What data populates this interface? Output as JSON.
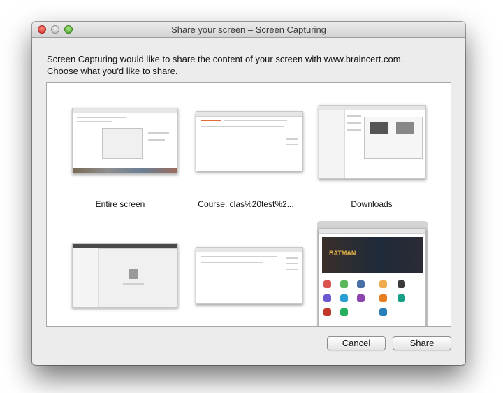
{
  "window": {
    "title": "Share your screen – Screen Capturing"
  },
  "message": {
    "line1": "Screen Capturing would like to share the content of your screen with www.braincert.com.",
    "line2": "Choose what you'd like to share."
  },
  "sources": [
    {
      "label": "Entire screen",
      "selected": false
    },
    {
      "label": "Course. clas%20test%2...",
      "selected": false
    },
    {
      "label": "Downloads",
      "selected": false
    },
    {
      "label": "",
      "selected": false
    },
    {
      "label": "",
      "selected": false
    },
    {
      "label": "",
      "selected": true
    }
  ],
  "buttons": {
    "cancel": "Cancel",
    "share": "Share"
  },
  "colors": {
    "close": "#d3302a",
    "minimize": "#b9b9b9",
    "maximize": "#4fa72b",
    "selection": "#d4d4d4"
  }
}
